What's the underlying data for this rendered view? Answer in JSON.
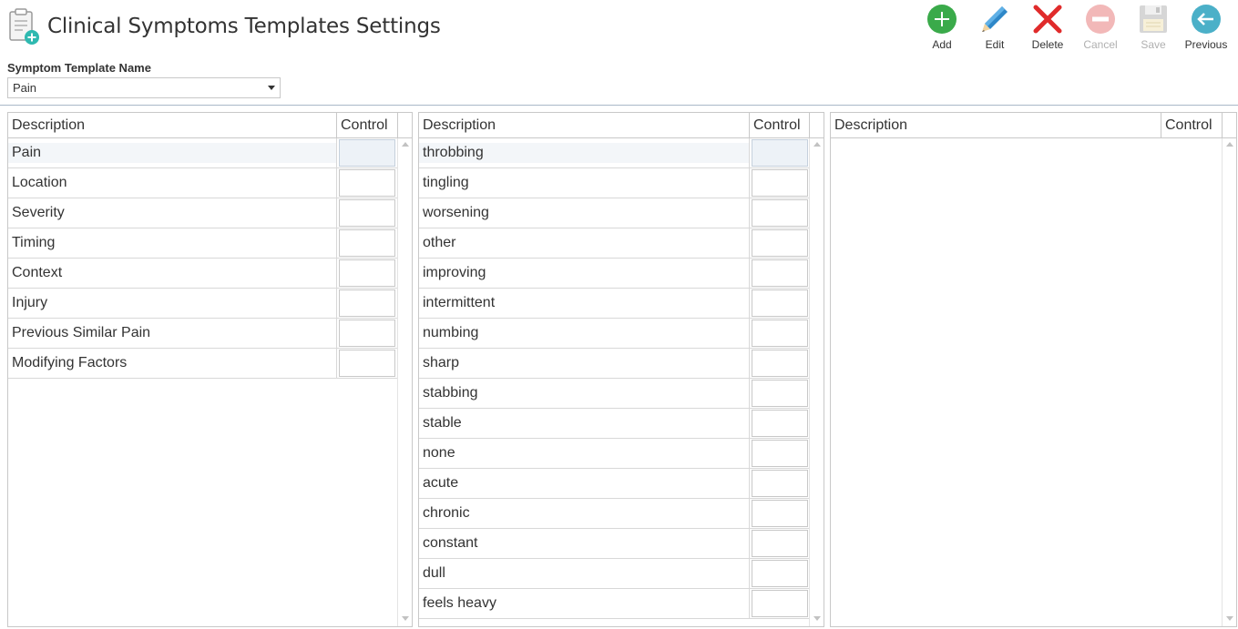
{
  "header": {
    "title": "Clinical Symptoms Templates Settings"
  },
  "toolbar": {
    "add_label": "Add",
    "edit_label": "Edit",
    "delete_label": "Delete",
    "cancel_label": "Cancel",
    "save_label": "Save",
    "previous_label": "Previous"
  },
  "template": {
    "label": "Symptom Template Name",
    "value": "Pain"
  },
  "grid1": {
    "col_description": "Description",
    "col_control": "Control",
    "rows": [
      "Pain",
      "Location",
      "Severity",
      "Timing",
      "Context",
      "Injury",
      "Previous Similar Pain",
      "Modifying Factors"
    ]
  },
  "grid2": {
    "col_description": "Description",
    "col_control": "Control",
    "rows": [
      "throbbing",
      "tingling",
      "worsening",
      "other",
      "improving",
      "intermittent",
      "numbing",
      "sharp",
      "stabbing",
      "stable",
      "none",
      "acute",
      "chronic",
      "constant",
      "dull",
      "feels heavy"
    ]
  },
  "grid3": {
    "col_description": "Description",
    "col_control": "Control",
    "rows": []
  },
  "colors": {
    "add": "#3aaa4a",
    "edit": "#2e87c8",
    "delete": "#e02b2b",
    "disabled": "#f2b8b8",
    "previous": "#4bb0c8"
  }
}
